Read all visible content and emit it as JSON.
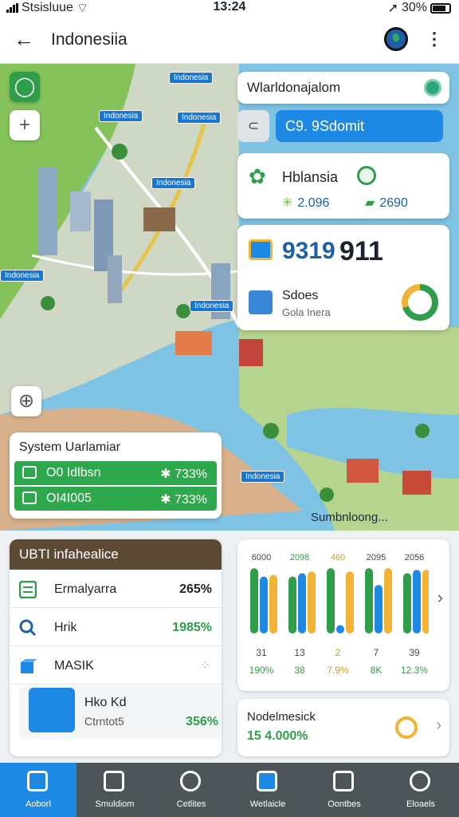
{
  "status_bar": {
    "carrier": "Stsisluue",
    "time": "13:24",
    "battery": "30%"
  },
  "header": {
    "title": "Indonesiia",
    "back_icon": "back-arrow-icon",
    "globe_icon": "globe-icon",
    "more_icon": "more-vertical-icon"
  },
  "map": {
    "pins": [
      "Indonesia",
      "Indonesia",
      "Indonesia",
      "Indonesia",
      "Indonesia",
      "Indonesia",
      "Indonesia"
    ],
    "footer_label": "Sumbnloong..."
  },
  "search": {
    "label": "Wlarldonajalom",
    "field_value": "C9. 9Sdomit"
  },
  "region": {
    "name": "Hblansia",
    "stat1": "2.096",
    "stat2": "2690"
  },
  "stats": {
    "value1": "9319",
    "value2": "911",
    "label": "Sdoes",
    "sub": "Gola Inera"
  },
  "system": {
    "title": "System Uarlamiar",
    "rows": [
      {
        "name": "O0 Idlbsn",
        "value": "✱ 733%"
      },
      {
        "name": "OI4I005",
        "value": "✱ 733%"
      }
    ]
  },
  "infra": {
    "title": "UBTI infahealice",
    "rows": [
      {
        "name": "Ermalyarra",
        "value": "265%"
      },
      {
        "name": "Hrik",
        "value": "1985%"
      },
      {
        "name": "MASIK",
        "value": ""
      }
    ],
    "tile": {
      "title": "Hko Kd",
      "sub": "Ctrntot5",
      "value": "356%"
    }
  },
  "chart_data": {
    "type": "bar",
    "top_labels": [
      "6000",
      "2098",
      "460",
      "2095",
      "2056"
    ],
    "bottom_labels": [
      "31",
      "13",
      "2",
      "7",
      "39"
    ],
    "percent_labels": [
      "190%",
      "38",
      "7.9%",
      "8K",
      "12.3%"
    ],
    "series": [
      {
        "values": [
          7.8,
          6.8,
          7.8,
          7.8,
          7.2
        ],
        "color": "#2e9e4a"
      },
      {
        "values": [
          6.8,
          7.2,
          1.0,
          5.8,
          7.6
        ],
        "color": "#1e88e5"
      },
      {
        "values": [
          7.0,
          7.4,
          7.4,
          7.8,
          7.6
        ],
        "color": "#f2b233"
      }
    ]
  },
  "bottom_card": {
    "title": "Nodelmesick",
    "value": "15  4.000%"
  },
  "nav": [
    "Aoborl",
    "Smuldiom",
    "Cetlites",
    "Wetlaicle",
    "Oontbes",
    "Eloaels"
  ]
}
